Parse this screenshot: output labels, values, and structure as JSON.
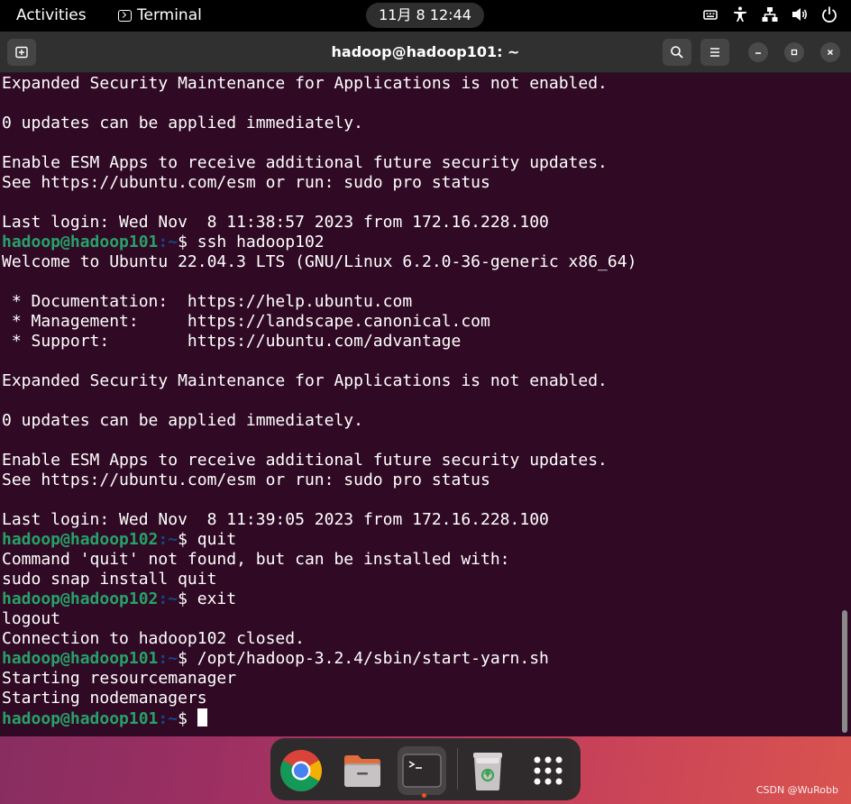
{
  "topbar": {
    "activities": "Activities",
    "app_name": "Terminal",
    "clock": "11月 8  12:44",
    "tray_icons": [
      "keyboard-icon",
      "accessibility-icon",
      "network-icon",
      "volume-icon",
      "power-icon"
    ]
  },
  "window": {
    "title": "hadoop@hadoop101: ~",
    "buttons": [
      "new-tab-icon",
      "search-icon",
      "menu-icon",
      "minimize-icon",
      "maximize-icon",
      "close-icon"
    ]
  },
  "terminal": {
    "lines": [
      {
        "text": "Expanded Security Maintenance for Applications is not enabled."
      },
      {
        "text": ""
      },
      {
        "text": "0 updates can be applied immediately."
      },
      {
        "text": ""
      },
      {
        "text": "Enable ESM Apps to receive additional future security updates."
      },
      {
        "text": "See https://ubuntu.com/esm or run: sudo pro status"
      },
      {
        "text": ""
      },
      {
        "text": "Last login: Wed Nov  8 11:38:57 2023 from 172.16.228.100"
      },
      {
        "user": "hadoop@hadoop101",
        "path": ":~",
        "cmd": "$ ssh hadoop102"
      },
      {
        "text": "Welcome to Ubuntu 22.04.3 LTS (GNU/Linux 6.2.0-36-generic x86_64)"
      },
      {
        "text": ""
      },
      {
        "text": " * Documentation:  https://help.ubuntu.com"
      },
      {
        "text": " * Management:     https://landscape.canonical.com"
      },
      {
        "text": " * Support:        https://ubuntu.com/advantage"
      },
      {
        "text": ""
      },
      {
        "text": "Expanded Security Maintenance for Applications is not enabled."
      },
      {
        "text": ""
      },
      {
        "text": "0 updates can be applied immediately."
      },
      {
        "text": ""
      },
      {
        "text": "Enable ESM Apps to receive additional future security updates."
      },
      {
        "text": "See https://ubuntu.com/esm or run: sudo pro status"
      },
      {
        "text": ""
      },
      {
        "text": "Last login: Wed Nov  8 11:39:05 2023 from 172.16.228.100"
      },
      {
        "user": "hadoop@hadoop102",
        "path": ":~",
        "cmd": "$ quit"
      },
      {
        "text": "Command 'quit' not found, but can be installed with:"
      },
      {
        "text": "sudo snap install quit"
      },
      {
        "user": "hadoop@hadoop102",
        "path": ":~",
        "cmd": "$ exit"
      },
      {
        "text": "logout"
      },
      {
        "text": "Connection to hadoop102 closed."
      },
      {
        "user": "hadoop@hadoop101",
        "path": ":~",
        "cmd": "$ /opt/hadoop-3.2.4/sbin/start-yarn.sh"
      },
      {
        "text": "Starting resourcemanager"
      },
      {
        "text": "Starting nodemanagers"
      },
      {
        "user": "hadoop@hadoop101",
        "path": ":~",
        "cmd": "$ ",
        "cursor": true
      }
    ]
  },
  "dock": {
    "apps": [
      "chrome-icon",
      "files-icon",
      "terminal-icon",
      "trash-icon",
      "app-grid-icon"
    ]
  },
  "watermark": "CSDN @WuRobb",
  "colors": {
    "terminal_bg": "#300a24",
    "prompt_user": "#26a269",
    "prompt_path": "#12488b",
    "accent": "#e95420"
  }
}
